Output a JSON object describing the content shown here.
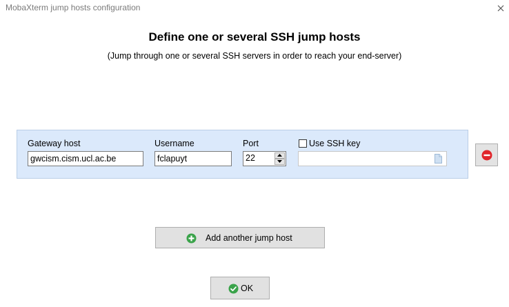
{
  "window": {
    "title": "MobaXterm jump hosts configuration"
  },
  "header": {
    "title": "Define one or several SSH jump hosts",
    "subtitle": "(Jump through one or several SSH servers in order to reach your end-server)"
  },
  "jump_host": {
    "gateway_label": "Gateway host",
    "gateway_value": "gwcism.cism.ucl.ac.be",
    "username_label": "Username",
    "username_value": "fclapuyt",
    "port_label": "Port",
    "port_value": "22",
    "use_ssh_key_label": "Use SSH key",
    "use_ssh_key_checked": false,
    "ssh_key_path": ""
  },
  "actions": {
    "add_host_label": "Add another jump host",
    "ok_label": "OK"
  },
  "icons": {
    "close": "close-icon",
    "remove": "minus-circle-icon",
    "add": "plus-circle-icon",
    "ok": "check-circle-icon",
    "file": "file-icon"
  },
  "colors": {
    "panel_background": "#dbe9fb",
    "remove_red": "#e0262b",
    "add_green": "#3aa34a",
    "ok_green": "#3aa34a"
  }
}
